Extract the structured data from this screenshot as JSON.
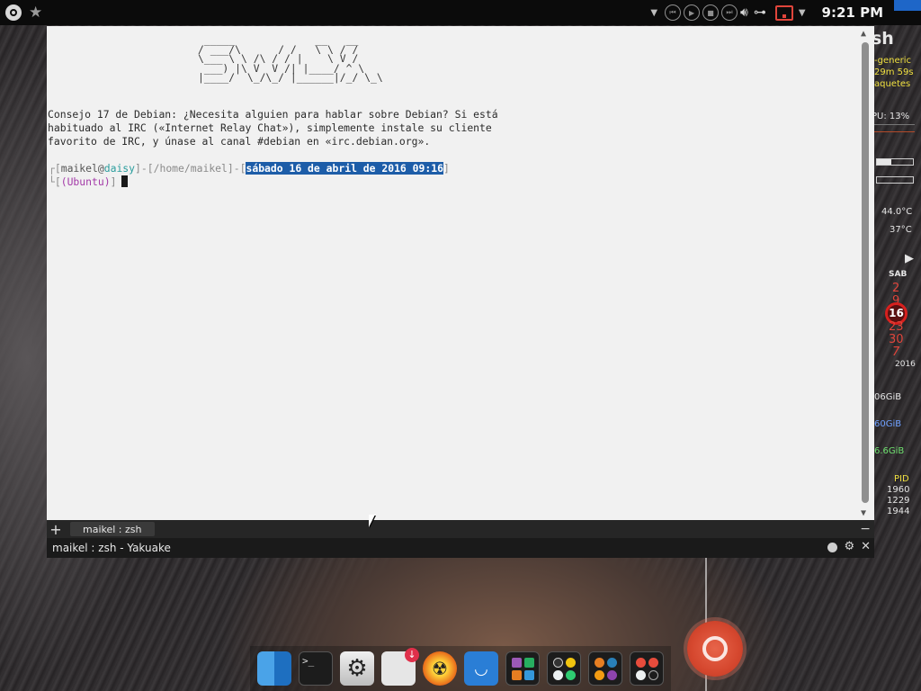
{
  "top_panel": {
    "clock": "9:21 PM",
    "colors": {
      "panel_bg": "#0b0b0b",
      "clock_text": "#f2f2f2",
      "notification": "#e0453b",
      "corner_square": "#1e66c8"
    },
    "left_icons": [
      "menu-icon",
      "star-icon"
    ],
    "media_icons": [
      "previous-icon",
      "play-icon",
      "stop-icon",
      "next-icon"
    ],
    "tray_icons": [
      "volume-icon",
      "network-icon",
      "notification-icon",
      "chevron-down-icon"
    ]
  },
  "conky": {
    "title": "sh",
    "kernel": "-generic",
    "uptime": "29m 59s",
    "packages": "aquetes",
    "cpu": "PU: 13%",
    "ram_usage": 0.4,
    "swap_usage": 0.0,
    "temp1": "44.0°C",
    "temp2": "37°C",
    "calendar": {
      "weekday": "SAB",
      "days": [
        "2",
        "9",
        "16",
        "23",
        "30",
        "7"
      ],
      "today": "16",
      "year": "2016"
    },
    "disk1": "06GiB",
    "disk2": "60GiB",
    "disk3": "6.6GiB",
    "proc_header": "PID",
    "pids": [
      "1960",
      "1229",
      "1944"
    ]
  },
  "terminal": {
    "ascii_banner": " _____             __   __\n/ ___/\\      / /   \\ \\ / /\n\\___ \\ \\ /\\ / / |    \\ V /\n ___) |\\ V  V /| |____/ ^ \\\n|____/  \\_/\\_/ |______|/_/ \\_\\",
    "tip": "Consejo 17 de Debian: ¿Necesita alguien para hablar sobre Debian? Si está habituado al IRC («Internet Relay Chat»), simplemente instale su cliente favorito de IRC, y únase al canal #debian en «irc.debian.org».",
    "prompt": {
      "open": "┌[",
      "user": "maikel",
      "at": "@",
      "host": "daisy",
      "sep1": "]-[",
      "path": "/home/maikel",
      "sep2": "]-[",
      "datetime": "sábado 16 de abril de 2016 09:16",
      "close": "]",
      "line2_open": "└[",
      "dist": "(Ubuntu)",
      "line2_close": "]"
    },
    "colors": {
      "bg": "#f1f1f1",
      "host": "#2a9d9d",
      "highlight": "#1d5da8",
      "dist": "#a33aa8"
    }
  },
  "yakuake": {
    "add_tab": "+",
    "tab_label": "maikel : zsh",
    "tab_close": "−",
    "window_title": "maikel : zsh - Yakuake",
    "settings_icon": "gear-icon",
    "close": "✕"
  },
  "dock": {
    "items": [
      "finder-icon",
      "terminal-icon",
      "settings-icon",
      "downloader-icon",
      "nuclear-icon",
      "deepin-icon",
      "apps-grid-icon",
      "media-grid-icon",
      "browsers-grid-icon",
      "tools-grid-icon"
    ]
  },
  "ubuntu_button": "ubuntu-logo-icon"
}
